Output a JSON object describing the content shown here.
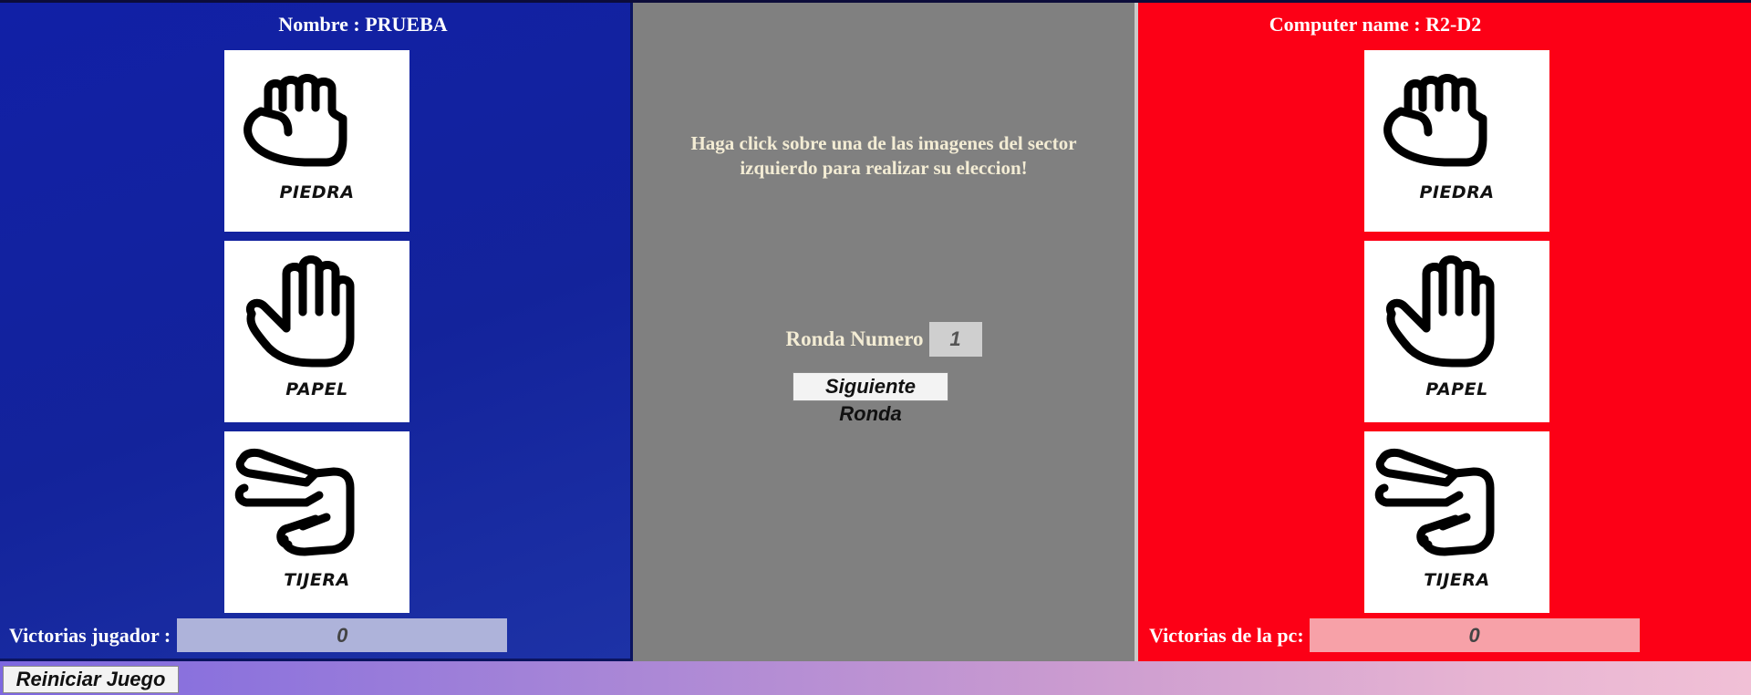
{
  "player": {
    "name_label": "Nombre :  PRUEBA",
    "cards": [
      {
        "label": "PIEDRA",
        "icon": "fist-icon"
      },
      {
        "label": "PAPEL",
        "icon": "open-hand-icon"
      },
      {
        "label": "TIJERA",
        "icon": "scissors-hand-icon"
      }
    ],
    "score_label": "Victorias jugador :",
    "score_value": "0",
    "color": "#1120a6"
  },
  "middle": {
    "instruction_line1": "Haga click sobre una de las imagenes del sector",
    "instruction_line2": "izquierdo para realizar su eleccion!",
    "round_label": "Ronda Numero",
    "round_value": "1",
    "next_button": "Siguiente Ronda",
    "color": "#808080"
  },
  "computer": {
    "name_label": "Computer name : R2-D2",
    "cards": [
      {
        "label": "PIEDRA",
        "icon": "fist-icon"
      },
      {
        "label": "PAPEL",
        "icon": "open-hand-icon"
      },
      {
        "label": "TIJERA",
        "icon": "scissors-hand-icon"
      }
    ],
    "score_label": "Victorias de la pc:",
    "score_value": "0",
    "color": "#fc0016"
  },
  "footer": {
    "reset_button": "Reiniciar Juego"
  }
}
